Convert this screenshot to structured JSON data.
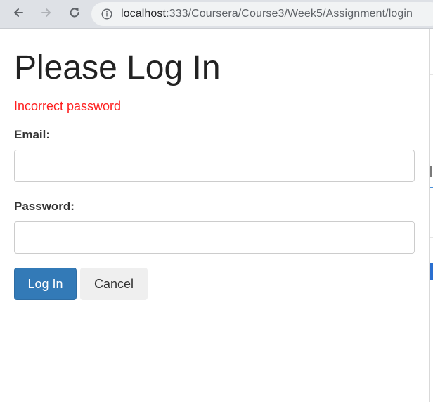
{
  "browser": {
    "url_host": "localhost",
    "url_path": ":333/Coursera/Course3/Week5/Assignment/login"
  },
  "page": {
    "title": "Please Log In",
    "error_message": "Incorrect password"
  },
  "form": {
    "email_label": "Email:",
    "email_value": "",
    "password_label": "Password:",
    "password_value": ""
  },
  "buttons": {
    "login_label": "Log In",
    "cancel_label": "Cancel"
  },
  "colors": {
    "primary": "#337ab7",
    "error": "#ff1f1f",
    "secondary_button": "#efefef"
  }
}
